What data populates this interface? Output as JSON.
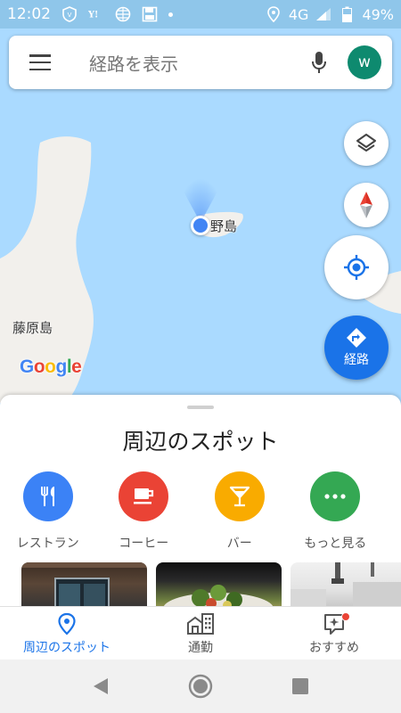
{
  "status_bar": {
    "time": "12:02",
    "network": "4G",
    "battery": "49%",
    "icons": [
      "vpn-shield-icon",
      "yahoo-icon",
      "globe-icon",
      "save-icon",
      "notification-dot",
      "location-icon",
      "signal-icon",
      "battery-icon"
    ]
  },
  "search": {
    "placeholder": "経路を表示",
    "avatar_letter": "w",
    "avatar_color": "#0e8a6f"
  },
  "map": {
    "labels": {
      "fujiwara": "藤原島",
      "island": "野島"
    },
    "logo_letters": [
      "G",
      "o",
      "o",
      "g",
      "l",
      "e"
    ],
    "water_color": "#aadaff",
    "land_color": "#f2f0ec"
  },
  "controls": {
    "directions_label": "経路",
    "accent": "#1a73e8"
  },
  "sheet": {
    "title": "周辺のスポット",
    "categories": [
      {
        "label": "レストラン",
        "icon": "fork-knife-icon",
        "color": "#3b82f6"
      },
      {
        "label": "コーヒー",
        "icon": "coffee-cup-icon",
        "color": "#ea4335"
      },
      {
        "label": "バー",
        "icon": "cocktail-icon",
        "color": "#f9ab00"
      },
      {
        "label": "もっと見る",
        "icon": "more-dots-icon",
        "color": "#34a853"
      }
    ]
  },
  "bottom_nav": {
    "items": [
      {
        "label": "周辺のスポット",
        "icon": "location-pin-icon"
      },
      {
        "label": "通勤",
        "icon": "commute-buildings-icon"
      },
      {
        "label": "おすすめ",
        "icon": "updates-sparkle-icon"
      }
    ]
  }
}
